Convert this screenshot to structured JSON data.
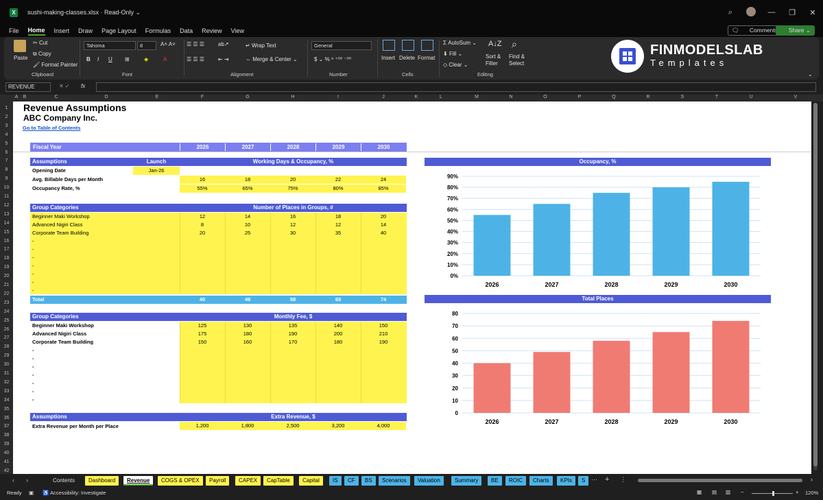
{
  "window": {
    "file_title": "sushi-making-classes.xlsx  ·  Read-Only ⌄",
    "app_icon": "X"
  },
  "menu": {
    "items": [
      "File",
      "Home",
      "Insert",
      "Draw",
      "Page Layout",
      "Formulas",
      "Data",
      "Review",
      "View"
    ],
    "comments": "Comments",
    "share": "Share ⌄"
  },
  "ribbon": {
    "paste": "Paste",
    "cut": "Cut",
    "copy": "Copy",
    "format_painter": "Format Painter",
    "clipboard": "Clipboard",
    "font_name": "Tahoma",
    "font_size": "8",
    "font": "Font",
    "wrap_text": "Wrap Text",
    "merge_center": "Merge & Center",
    "alignment": "Alignment",
    "number_format": "General",
    "number": "Number",
    "insert": "Insert",
    "delete": "Delete",
    "format": "Format",
    "cells": "Cells",
    "autosum": "AutoSum",
    "fill": "Fill",
    "clear": "Clear",
    "sort_filter": "Sort & Filter",
    "find_select": "Find & Select",
    "editing": "Editing",
    "brand_1": "FINMODELSLAB",
    "brand_2": "Templates"
  },
  "formula_bar": {
    "name_box": "REVENUE",
    "fx": "fx"
  },
  "columns": [
    "A",
    "B",
    "C",
    "D",
    "E",
    "F",
    "G",
    "H",
    "I",
    "J",
    "K",
    "L",
    "M",
    "N",
    "O",
    "P",
    "Q",
    "R",
    "S",
    "T",
    "U",
    "V"
  ],
  "rows": [
    "1",
    "2",
    "3",
    "4",
    "5",
    "6",
    "7",
    "8",
    "9",
    "10",
    "11",
    "12",
    "13",
    "14",
    "15",
    "16",
    "17",
    "18",
    "19",
    "20",
    "21",
    "22",
    "23",
    "24",
    "25",
    "26",
    "27",
    "28",
    "29",
    "30",
    "31",
    "32",
    "33",
    "34",
    "35",
    "36",
    "37",
    "38",
    "39",
    "40",
    "41",
    "42"
  ],
  "sheet": {
    "title": "Revenue Assumptions",
    "company": "ABC Company Inc.",
    "toc_link": "Go to Table of Contents",
    "fiscal_year_label": "Fiscal Year",
    "years": [
      "2026",
      "2027",
      "2028",
      "2029",
      "2030"
    ],
    "assumptions_label": "Assumptions",
    "launch_label": "Launch",
    "wd_header": "Working Days & Occupancy, %",
    "opening_date_label": "Opening Date",
    "opening_date": "Jan-26",
    "billable_label": "Avg. Billable Days per Month",
    "billable": [
      "16",
      "18",
      "20",
      "22",
      "24"
    ],
    "occupancy_label": "Occupancy Rate, %",
    "occupancy": [
      "55%",
      "65%",
      "75%",
      "80%",
      "85%"
    ],
    "group_categories_label": "Group Categories",
    "places_header": "Number of Places in Groups, #",
    "places_rows": [
      {
        "name": "Beginner Maki Workshop",
        "v": [
          "12",
          "14",
          "16",
          "18",
          "20"
        ]
      },
      {
        "name": "Advanced Nigiri Class",
        "v": [
          "8",
          "10",
          "12",
          "12",
          "14"
        ]
      },
      {
        "name": "Corporate Team Building",
        "v": [
          "20",
          "25",
          "30",
          "35",
          "40"
        ]
      }
    ],
    "dash": "-",
    "total_label": "Total",
    "totals": [
      "40",
      "49",
      "58",
      "65",
      "74"
    ],
    "fee_header": "Monthly Fee, $",
    "fee_rows": [
      {
        "name": "Beginner Maki Workshop",
        "v": [
          "125",
          "130",
          "135",
          "140",
          "150"
        ]
      },
      {
        "name": "Advanced Nigiri Class",
        "v": [
          "175",
          "180",
          "190",
          "200",
          "210"
        ]
      },
      {
        "name": "Corporate Team Building",
        "v": [
          "150",
          "160",
          "170",
          "180",
          "190"
        ]
      }
    ],
    "extra_header": "Extra Revenue, $",
    "extra_label": "Extra Revenue per Month per Place",
    "extra": [
      "1,200",
      "1,800",
      "2,500",
      "3,200",
      "4,000"
    ]
  },
  "chart_data": [
    {
      "type": "bar",
      "title": "Occupancy, %",
      "categories": [
        "2026",
        "2027",
        "2028",
        "2029",
        "2030"
      ],
      "values": [
        55,
        65,
        75,
        80,
        85
      ],
      "ylim": [
        0,
        90
      ],
      "yticks": [
        "0%",
        "10%",
        "20%",
        "30%",
        "40%",
        "50%",
        "60%",
        "70%",
        "80%",
        "90%"
      ],
      "color": "#4db3e6"
    },
    {
      "type": "bar",
      "title": "Total Places",
      "categories": [
        "2026",
        "2027",
        "2028",
        "2029",
        "2030"
      ],
      "values": [
        40,
        49,
        58,
        65,
        74
      ],
      "ylim": [
        0,
        80
      ],
      "yticks": [
        "0",
        "10",
        "20",
        "30",
        "40",
        "50",
        "60",
        "70",
        "80"
      ],
      "color": "#f07b72"
    }
  ],
  "tabs": [
    "Contents",
    "Dashboard",
    "Revenue",
    "COGS & OPEX",
    "Payroll",
    "CAPEX",
    "CapTable",
    "Capital",
    "IS",
    "CF",
    "BS",
    "Scenarios",
    "Valuation",
    "Summary",
    "BE",
    "ROIC",
    "Charts",
    "KPIs",
    "S"
  ],
  "status": {
    "ready": "Ready",
    "accessibility": "Accessibility: Investigate",
    "zoom": "120%"
  }
}
